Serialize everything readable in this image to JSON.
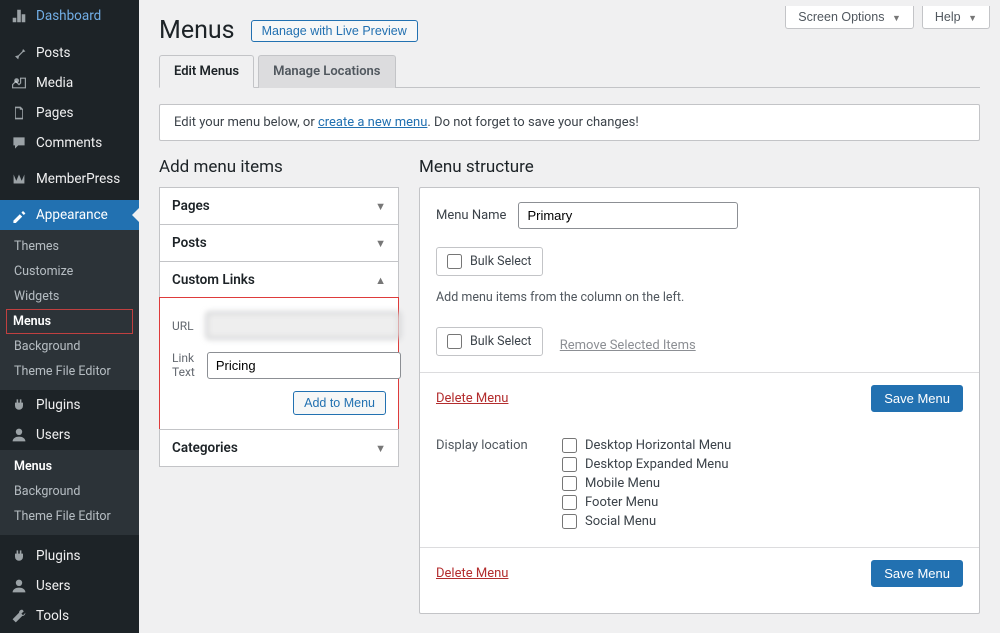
{
  "topbar": {
    "screen_options": "Screen Options",
    "help": "Help"
  },
  "sidebar": {
    "items": [
      {
        "label": "Dashboard",
        "icon": "dashboard"
      },
      {
        "label": "Posts",
        "icon": "pin"
      },
      {
        "label": "Media",
        "icon": "media"
      },
      {
        "label": "Pages",
        "icon": "pages"
      },
      {
        "label": "Comments",
        "icon": "comment"
      },
      {
        "label": "MemberPress",
        "icon": "memberpress"
      },
      {
        "label": "Appearance",
        "icon": "appearance",
        "current": true
      },
      {
        "label": "Plugins",
        "icon": "plugin"
      },
      {
        "label": "Users",
        "icon": "user"
      },
      {
        "label": "Plugins",
        "icon": "plugin"
      },
      {
        "label": "Users",
        "icon": "user"
      },
      {
        "label": "Tools",
        "icon": "tool"
      }
    ],
    "appearance_sub": [
      {
        "label": "Themes"
      },
      {
        "label": "Customize"
      },
      {
        "label": "Widgets"
      },
      {
        "label": "Menus",
        "current": true
      },
      {
        "label": "Background"
      },
      {
        "label": "Theme File Editor"
      }
    ],
    "users_sub": [
      {
        "label": "Menus",
        "current": true
      },
      {
        "label": "Background"
      },
      {
        "label": "Theme File Editor"
      }
    ]
  },
  "page": {
    "title": "Menus",
    "action_button": "Manage with Live Preview",
    "tabs": {
      "edit": "Edit Menus",
      "locations": "Manage Locations"
    },
    "notice_prefix": "Edit your menu below, or ",
    "notice_link": "create a new menu",
    "notice_suffix": ". Do not forget to save your changes!"
  },
  "add_items": {
    "heading": "Add menu items",
    "panels": {
      "pages": "Pages",
      "posts": "Posts",
      "custom_links": "Custom Links",
      "categories": "Categories"
    },
    "custom": {
      "url_label": "URL",
      "url_value": "",
      "link_text_label": "Link Text",
      "link_text_value": "Pricing",
      "add_button": "Add to Menu"
    }
  },
  "structure": {
    "heading": "Menu structure",
    "menu_name_label": "Menu Name",
    "menu_name_value": "Primary",
    "bulk_select": "Bulk Select",
    "instructions": "Add menu items from the column on the left.",
    "remove_selected": "Remove Selected Items",
    "delete_menu": "Delete Menu",
    "save_menu": "Save Menu",
    "display_location_label": "Display location",
    "locations": [
      "Desktop Horizontal Menu",
      "Desktop Expanded Menu",
      "Mobile Menu",
      "Footer Menu",
      "Social Menu"
    ]
  }
}
